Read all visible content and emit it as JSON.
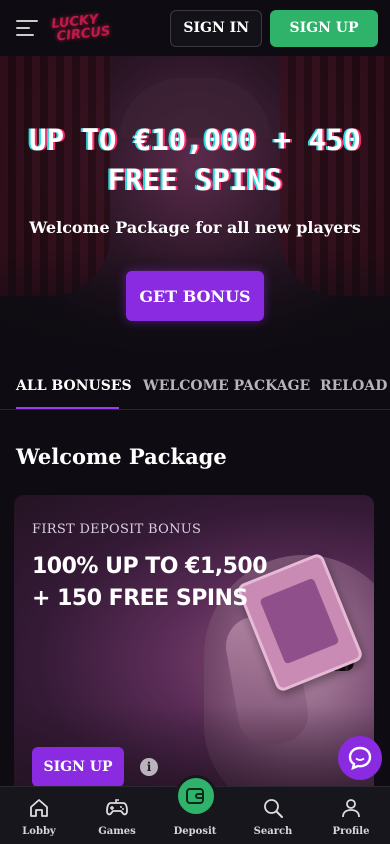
{
  "header": {
    "logo_line1": "LUCKY",
    "logo_line2": "CIRCUS",
    "signin_label": "SIGN IN",
    "signup_label": "SIGN UP"
  },
  "hero": {
    "title_line1": "UP TO €10,000 + 450",
    "title_line2": "FREE SPINS",
    "subtitle": "Welcome Package for all new players",
    "cta_label": "GET BONUS"
  },
  "tabs": [
    {
      "label": "ALL BONUSES",
      "active": true
    },
    {
      "label": "WELCOME PACKAGE",
      "active": false
    },
    {
      "label": "RELOAD",
      "active": false
    }
  ],
  "section": {
    "title": "Welcome Package"
  },
  "card": {
    "label": "FIRST DEPOSIT BONUS",
    "offer_line1": "100% UP TO €1,500",
    "offer_line2": "+ 150 FREE SPINS",
    "signup_label": "SIGN UP",
    "info_icon": "i"
  },
  "bottom_nav": [
    {
      "label": "Lobby",
      "icon": "home-icon"
    },
    {
      "label": "Games",
      "icon": "gamepad-icon"
    },
    {
      "label": "Deposit",
      "icon": "wallet-icon"
    },
    {
      "label": "Search",
      "icon": "search-icon"
    },
    {
      "label": "Profile",
      "icon": "user-icon"
    }
  ],
  "colors": {
    "accent_purple": "#8a2be2",
    "accent_green": "#2fb26a",
    "background": "#0e0c12"
  }
}
